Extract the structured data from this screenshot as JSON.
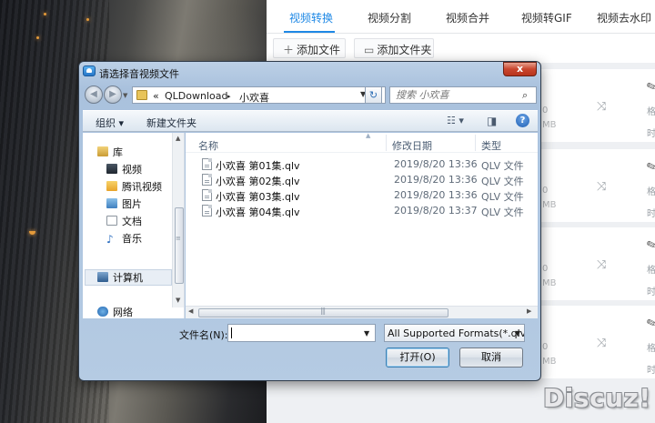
{
  "app": {
    "tabs": [
      "视频转换",
      "视频分割",
      "视频合并",
      "视频转GIF",
      "视频去水印"
    ],
    "toolbar": {
      "add_file": "添加文件",
      "add_folder": "添加文件夹"
    },
    "cards": [
      {
        "size_a": "0",
        "size_b": "MB",
        "col1": "格",
        "col2": "时"
      },
      {
        "size_a": "0",
        "size_b": "MB",
        "col1": "格",
        "col2": "时"
      },
      {
        "size_a": "0",
        "size_b": "MB",
        "col1": "格",
        "col2": "时"
      },
      {
        "size_a": "0",
        "size_b": "MB",
        "col1": "格",
        "col2": "时"
      }
    ],
    "icons": {
      "add": "plus-icon",
      "folder": "folder-icon",
      "shuffle": "shuffle-icon",
      "edit": "pencil-icon"
    },
    "accent_color": "#1e88e5"
  },
  "dialog": {
    "title": "请选择音视频文件",
    "close_label": "x",
    "address": {
      "prefix": "«",
      "crumbs": [
        "QLDownload",
        "小欢喜"
      ],
      "separator": "▸"
    },
    "search": {
      "placeholder": "搜索 小欢喜"
    },
    "commands": {
      "organize": "组织 ▾",
      "new_folder": "新建文件夹"
    },
    "nav": {
      "items": [
        {
          "label": "库",
          "icon": "library-icon"
        },
        {
          "label": "视频",
          "icon": "video-library-icon"
        },
        {
          "label": "腾讯视频",
          "icon": "tencent-video-icon"
        },
        {
          "label": "图片",
          "icon": "pictures-icon"
        },
        {
          "label": "文档",
          "icon": "documents-icon"
        },
        {
          "label": "音乐",
          "icon": "music-icon"
        },
        {
          "label": "计算机",
          "icon": "computer-icon"
        },
        {
          "label": "网络",
          "icon": "network-icon"
        }
      ]
    },
    "columns": {
      "name": "名称",
      "date": "修改日期",
      "type": "类型"
    },
    "files": [
      {
        "name": "小欢喜 第01集.qlv",
        "date": "2019/8/20 13:36",
        "type": "QLV 文件"
      },
      {
        "name": "小欢喜 第02集.qlv",
        "date": "2019/8/20 13:36",
        "type": "QLV 文件"
      },
      {
        "name": "小欢喜 第03集.qlv",
        "date": "2019/8/20 13:36",
        "type": "QLV 文件"
      },
      {
        "name": "小欢喜 第04集.qlv",
        "date": "2019/8/20 13:37",
        "type": "QLV 文件"
      }
    ],
    "filename": {
      "label": "文件名(N):",
      "value": ""
    },
    "filter": {
      "selected": "All Supported Formats(*.qlv;"
    },
    "buttons": {
      "open": "打开(O)",
      "cancel": "取消"
    }
  },
  "watermark": "Discuz!"
}
